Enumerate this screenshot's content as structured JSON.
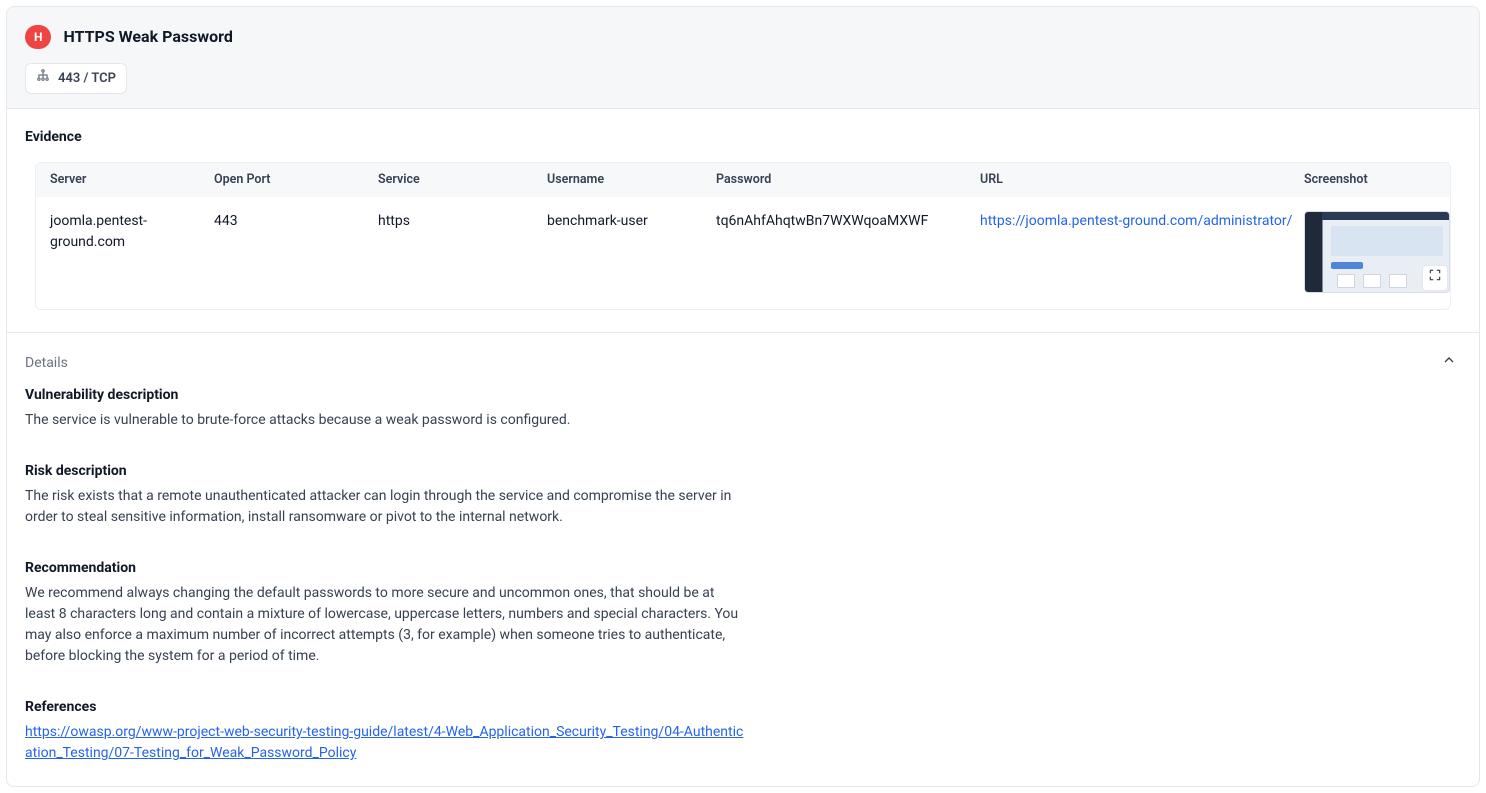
{
  "header": {
    "severity_letter": "H",
    "title": "HTTPS Weak Password",
    "port_chip": "443 / TCP"
  },
  "evidence": {
    "section_title": "Evidence",
    "columns": {
      "server": "Server",
      "open_port": "Open Port",
      "service": "Service",
      "username": "Username",
      "password": "Password",
      "url": "URL",
      "screenshot": "Screenshot"
    },
    "row": {
      "server": "joomla.pentest-ground.com",
      "open_port": "443",
      "service": "https",
      "username": "benchmark-user",
      "password": "tq6nAhfAhqtwBn7WXWqoaMXWF",
      "url": "https://joomla.pentest-ground.com/administrator/"
    }
  },
  "details": {
    "header": "Details",
    "vuln_label": "Vulnerability description",
    "vuln_text": "The service is vulnerable to brute-force attacks because a weak password is configured.",
    "risk_label": "Risk description",
    "risk_text": "The risk exists that a remote unauthenticated attacker can login through the service and compromise the server in order to steal sensitive information, install ransomware or pivot to the internal network.",
    "rec_label": "Recommendation",
    "rec_text": "We recommend always changing the default passwords to more secure and uncommon ones, that should be at least 8 characters long and contain a mixture of lowercase, uppercase letters, numbers and special characters. You may also enforce a maximum number of incorrect attempts (3, for example) when someone tries to authenticate, before blocking the system for a period of time.",
    "ref_label": "References",
    "ref_link": "https://owasp.org/www-project-web-security-testing-guide/latest/4-Web_Application_Security_Testing/04-Authentication_Testing/07-Testing_for_Weak_Password_Policy"
  }
}
